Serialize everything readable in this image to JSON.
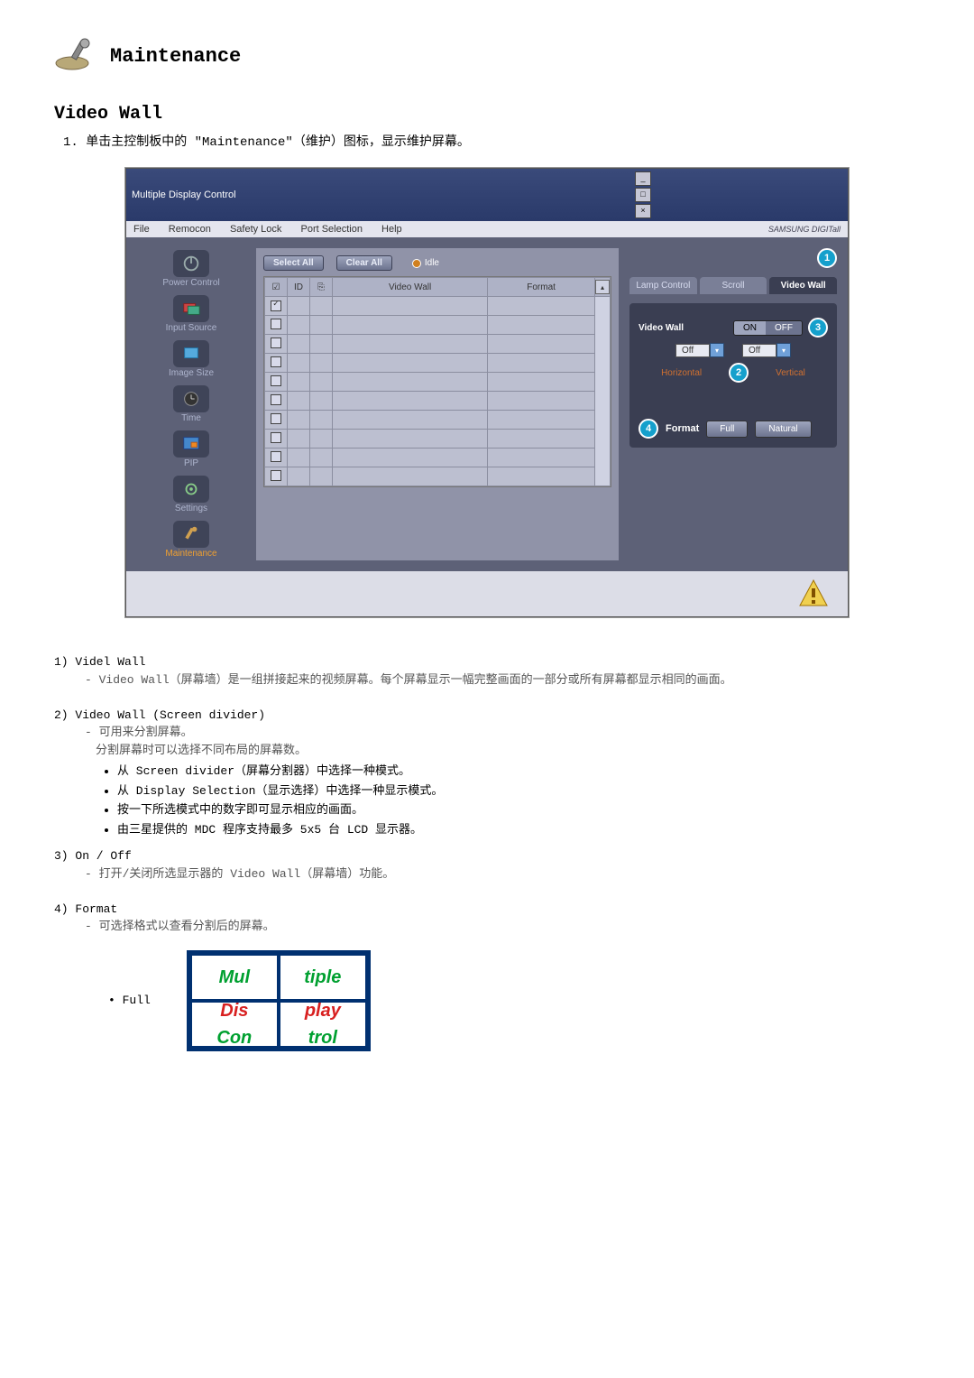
{
  "page": {
    "heading": "Maintenance",
    "section": "Video Wall",
    "step_1": "1.  单击主控制板中的 \"Maintenance\"（维护）图标，显示维护屏幕。"
  },
  "app": {
    "title": "Multiple Display Control",
    "menus": [
      "File",
      "Remocon",
      "Safety Lock",
      "Port Selection",
      "Help"
    ],
    "brand": "SAMSUNG DIGITall",
    "sidebar": [
      {
        "label": "Power Control"
      },
      {
        "label": "Input Source"
      },
      {
        "label": "Image Size"
      },
      {
        "label": "Time"
      },
      {
        "label": "PIP"
      },
      {
        "label": "Settings"
      },
      {
        "label": "Maintenance"
      }
    ],
    "toolbar": {
      "select_all": "Select All",
      "clear_all": "Clear All",
      "idle": "Idle"
    },
    "grid": {
      "headers": {
        "chk": "☑",
        "id": "ID",
        "icon": "",
        "vw": "Video Wall",
        "fmt": "Format"
      },
      "rows": 10
    },
    "right": {
      "tabs": [
        "Lamp Control",
        "Scroll",
        "Video Wall"
      ],
      "panel_title": "Video Wall",
      "on": "ON",
      "off": "OFF",
      "h_sel": "Off",
      "v_sel": "Off",
      "h_lbl": "Horizontal",
      "v_lbl": "Vertical",
      "format_lbl": "Format",
      "full": "Full",
      "natural": "Natural"
    },
    "callouts": {
      "c1": "1",
      "c2": "2",
      "c3": "3",
      "c4": "4"
    }
  },
  "desc": {
    "s1_t": "1) Videl Wall",
    "s1_b": "- Video Wall（屏幕墙）是一组拼接起来的视频屏幕。每个屏幕显示一幅完整画面的一部分或所有屏幕都显示相同的画面。",
    "s2_t": "2)  Video Wall (Screen divider)",
    "s2_a": "- 可用来分割屏幕。",
    "s2_b": "分割屏幕时可以选择不同布局的屏幕数。",
    "s2_li": [
      "从 Screen divider（屏幕分割器）中选择一种模式。",
      "从 Display Selection（显示选择）中选择一种显示模式。",
      "按一下所选模式中的数字即可显示相应的画面。",
      "由三星提供的 MDC 程序支持最多 5x5 台 LCD 显示器。"
    ],
    "s3_t": "3) On / Off",
    "s3_b": "- 打开/关闭所选显示器的 Video Wall（屏幕墙）功能。",
    "s4_t": "4)  Format",
    "s4_b": "- 可选择格式以查看分割后的屏幕。",
    "full_lbl": "Full"
  },
  "mdc": {
    "w1": "Mul",
    "w2": "tiple",
    "w3": "Dis",
    "w4": "play",
    "w5": "Con",
    "w6": "trol"
  }
}
